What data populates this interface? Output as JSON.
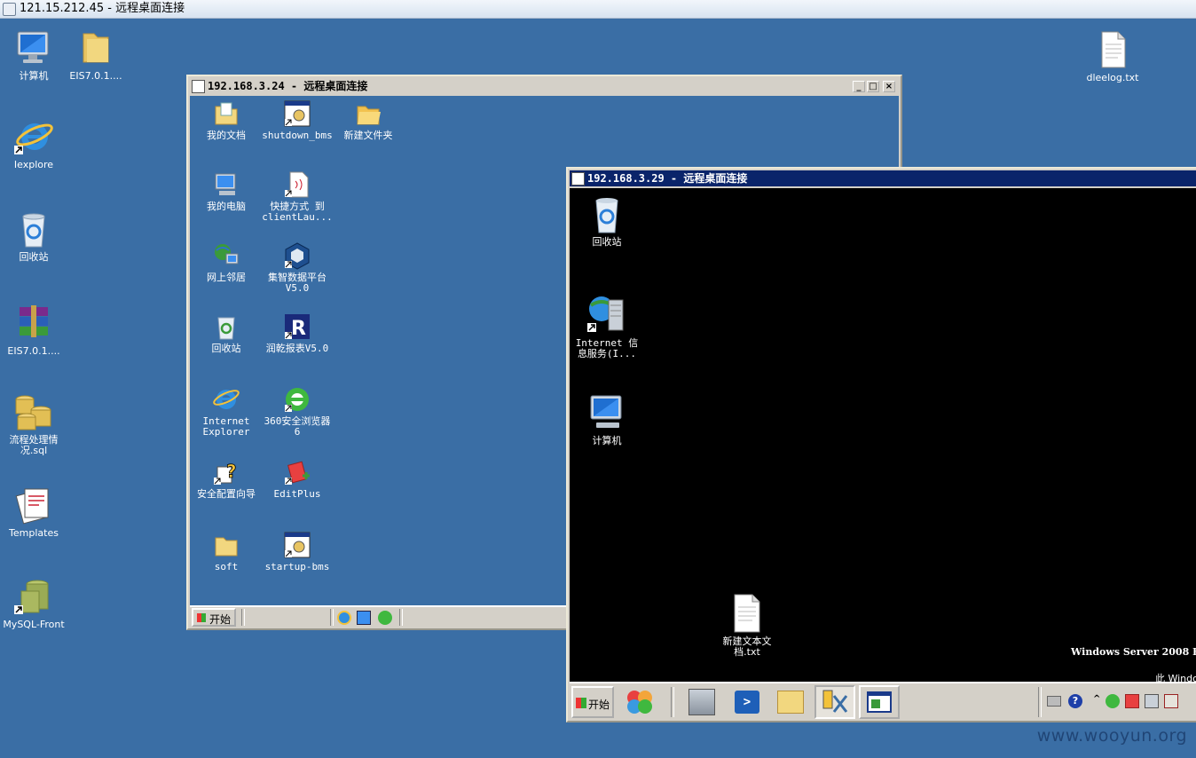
{
  "outer_window": {
    "title": "121.15.212.45 - 远程桌面连接"
  },
  "desktop_icons": [
    {
      "label": "计算机"
    },
    {
      "label": "EIS7.0.1...."
    },
    {
      "label": "Iexplore"
    },
    {
      "label": "回收站"
    },
    {
      "label": "EIS7.0.1...."
    },
    {
      "label": "流程处理情况.sql"
    },
    {
      "label": "Templates"
    },
    {
      "label": "MySQL-Front"
    },
    {
      "label": "dleelog.txt"
    }
  ],
  "window_324": {
    "title": "192.168.3.24 - 远程桌面连接",
    "icons": [
      {
        "label": "我的文档"
      },
      {
        "label": "shutdown_bms"
      },
      {
        "label": "新建文件夹"
      },
      {
        "label": "我的电脑"
      },
      {
        "label": "快捷方式 到 clientLau..."
      },
      {
        "label": "网上邻居"
      },
      {
        "label": "集智数据平台V5.0"
      },
      {
        "label": "回收站"
      },
      {
        "label": "润乾报表V5.0"
      },
      {
        "label": "Internet Explorer"
      },
      {
        "label": "360安全浏览器6"
      },
      {
        "label": "安全配置向导"
      },
      {
        "label": "EditPlus"
      },
      {
        "label": "soft"
      },
      {
        "label": "startup-bms"
      }
    ],
    "taskbar": {
      "start_label": "开始"
    }
  },
  "window_329": {
    "title": "192.168.3.29 - 远程桌面连接",
    "icons": [
      {
        "label": "回收站"
      },
      {
        "label": "Internet 信息服务(I..."
      },
      {
        "label": "计算机"
      },
      {
        "label": "新建文本文档.txt"
      }
    ],
    "os_text": "Windows Server 2008 R",
    "os_text2": "此 Window",
    "taskbar": {
      "start_label": "开始"
    }
  },
  "watermark": "www.wooyun.org",
  "colors": {
    "desktop": "#3a6ea5",
    "inner_desktop_329": "#000000",
    "window_frame": "#d4d0c8"
  }
}
